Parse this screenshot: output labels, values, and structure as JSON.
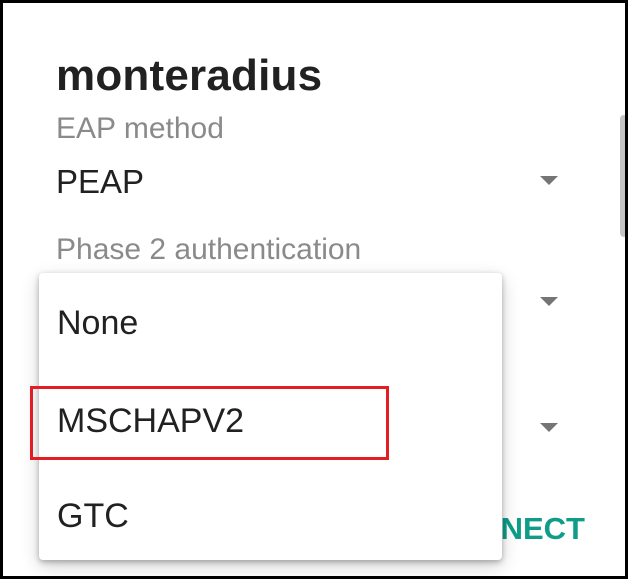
{
  "dialog": {
    "title": "monteradius",
    "eap_method": {
      "label": "EAP method",
      "value": "PEAP"
    },
    "phase2": {
      "label": "Phase 2 authentication"
    },
    "connect_label": "CONNECT"
  },
  "dropdown": {
    "options": [
      {
        "label": "None"
      },
      {
        "label": "MSCHAPV2"
      },
      {
        "label": "GTC"
      }
    ],
    "highlighted_option": "MSCHAPV2"
  },
  "colors": {
    "accent": "#0f9d8a",
    "highlight": "#e21d24"
  },
  "icons": {
    "dropdown_arrow": "caret-down-icon"
  }
}
